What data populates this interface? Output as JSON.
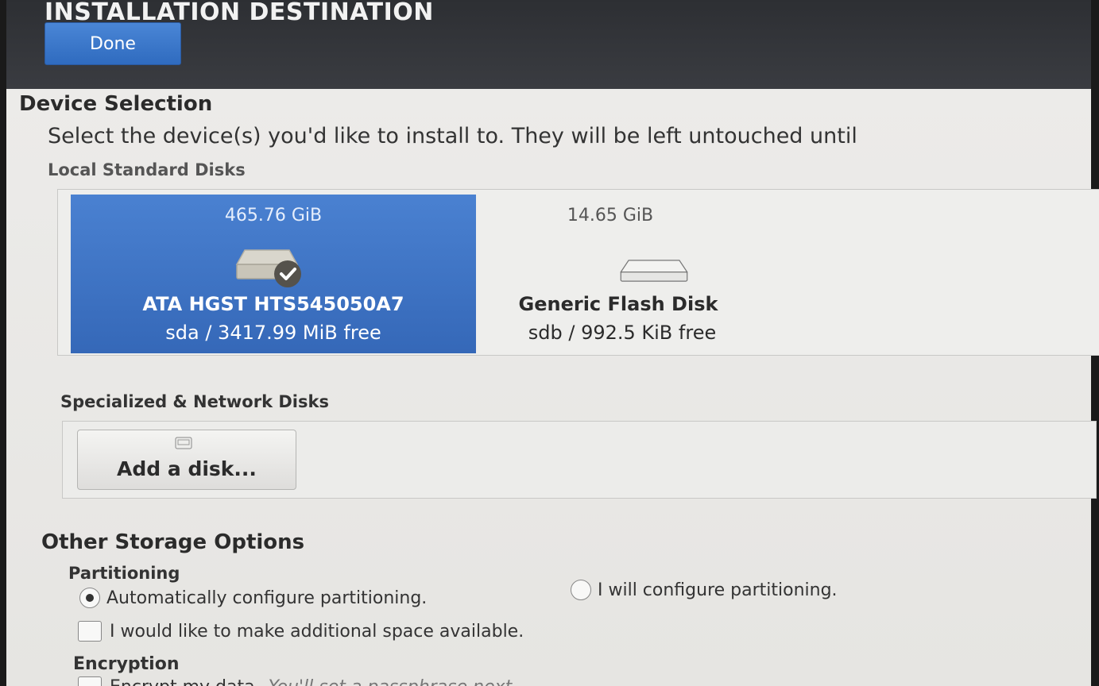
{
  "header": {
    "title": "INSTALLATION DESTINATION",
    "done_label": "Done"
  },
  "device_selection": {
    "title": "Device Selection",
    "instruction_prefix": "Select the device(s) you'd like to install to.",
    "instruction_suffix": "They will be left untouched until",
    "local_disks_label": "Local Standard Disks",
    "disks": [
      {
        "size": "465.76 GiB",
        "name": "ATA HGST HTS545050A7",
        "free": "sda  /  3417.99 MiB free",
        "selected": true
      },
      {
        "size": "14.65 GiB",
        "name": "Generic Flash Disk",
        "free": "sdb / 992.5 KiB free",
        "selected": false
      }
    ],
    "specialized_label": "Specialized & Network Disks",
    "add_disk_label": "Add a disk..."
  },
  "other_storage": {
    "title": "Other Storage Options",
    "partitioning_label": "Partitioning",
    "auto_label": "Automatically configure partitioning.",
    "manual_label": "I will configure partitioning.",
    "space_label": "I would like to make additional space available.",
    "encryption_label": "Encryption",
    "encrypt_label": "Encrypt my data.",
    "encrypt_hint": "You'll set a passphrase next."
  },
  "colors": {
    "accent": "#3a72c4",
    "header_bg": "#2d2f33"
  }
}
